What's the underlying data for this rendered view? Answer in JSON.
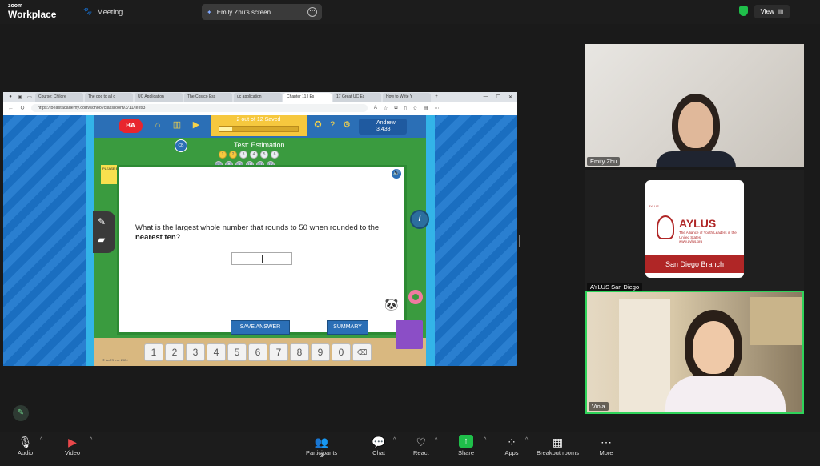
{
  "zoom": {
    "brand_top": "zoom",
    "brand_bottom": "Workplace",
    "meeting_label": "Meeting",
    "sharing_label": "Emily Zhu's screen",
    "view_label": "View"
  },
  "browser": {
    "tabs": [
      "Course: Childre",
      "The doc to all o",
      "UC Application",
      "The Costco Ess",
      "uc application",
      "Chapter 11 | Es",
      "17 Great UC Es",
      "How to Write Y"
    ],
    "active_tab_index": 5,
    "url": "https://beastacademy.com/school/classroom/3/11/test/3"
  },
  "game": {
    "saved_text": "2 out of 12 Saved",
    "saved_fraction": 0.1667,
    "user_name": "Andrew",
    "user_points": "3,438",
    "test_title": "Test: Estimation",
    "question_numbers_row1": [
      "1",
      "2",
      "3",
      "4",
      "5",
      "6"
    ],
    "question_numbers_row2": [
      "7",
      "8",
      "9",
      "10",
      "11",
      "12"
    ],
    "note_text": "PLEASE BE QUIET",
    "question_prefix": "What is the largest whole number that rounds to 50 when rounded to the ",
    "question_bold": "nearest ten",
    "question_suffix": "?",
    "save_label": "SAVE ANSWER",
    "summary_label": "SUMMARY",
    "keypad": [
      "1",
      "2",
      "3",
      "4",
      "5",
      "6",
      "7",
      "8",
      "9",
      "0"
    ],
    "copyright": "© AoPS Inc. 2024"
  },
  "participants_tiles": [
    {
      "name": "Emily Zhu"
    },
    {
      "name": "AYLUS San Diego"
    },
    {
      "name": "Viola"
    }
  ],
  "aylus": {
    "small": "AYLUS",
    "title": "AYLUS",
    "tagline": "The Alliance of Youth Leaders in the United States",
    "site": "www.aylus.org",
    "branch": "San Diego Branch"
  },
  "toolbar": {
    "audio": "Audio",
    "video": "Video",
    "participants": "Participants",
    "participants_count": "3",
    "chat": "Chat",
    "react": "React",
    "share": "Share",
    "apps": "Apps",
    "breakout": "Breakout rooms",
    "more": "More"
  },
  "colors": {
    "share_green": "#1fbf4a",
    "active_speaker_border": "#2fd35a",
    "aylus_red": "#b02626"
  }
}
